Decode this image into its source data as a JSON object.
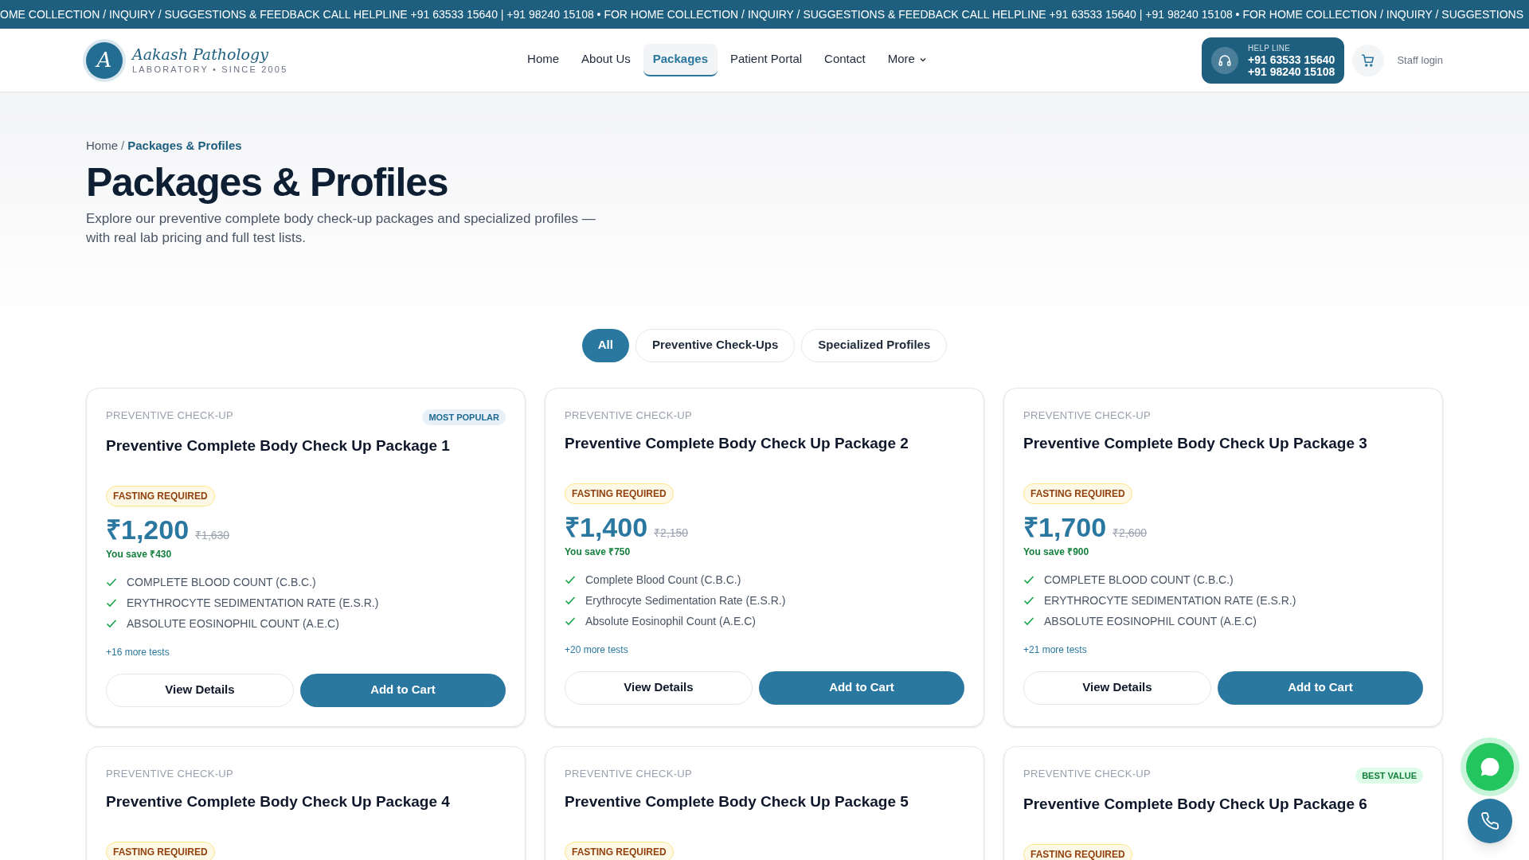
{
  "ticker": "OME COLLECTION / INQUIRY / SUGGESTIONS & FEEDBACK CALL HELPLINE +91 63533 15640 | +91 98240 15108 • FOR HOME COLLECTION / INQUIRY / SUGGESTIONS & FEEDBACK CALL HELPLINE +91 63533 15640 | +91 98240 15108 • FOR HOME COLLECTION / INQUIRY / SUGGESTIONS",
  "logo": {
    "letter": "A",
    "name": "Aakash Pathology",
    "tagline": "LABORATORY • SINCE 2005"
  },
  "nav": [
    {
      "label": "Home",
      "selected": false,
      "dropdown": false
    },
    {
      "label": "About Us",
      "selected": false,
      "dropdown": false
    },
    {
      "label": "Packages",
      "selected": true,
      "dropdown": false
    },
    {
      "label": "Patient Portal",
      "selected": false,
      "dropdown": false
    },
    {
      "label": "Contact",
      "selected": false,
      "dropdown": false
    },
    {
      "label": "More",
      "selected": false,
      "dropdown": true
    }
  ],
  "helpline": {
    "label": "HELP LINE",
    "numbers": [
      "+91 63533 15640",
      "+91 98240 15108"
    ]
  },
  "staff_login": "Staff login",
  "breadcrumb": [
    {
      "label": "Home",
      "selected": false
    },
    {
      "label": "Packages & Profiles",
      "selected": true
    }
  ],
  "breadcrumb_separator": "/",
  "title": "Packages & Profiles",
  "description": "Explore our preventive complete body check-up packages and specialized profiles — with real lab pricing and full test lists.",
  "filters": [
    {
      "label": "All",
      "selected": true
    },
    {
      "label": "Preventive Check-Ups",
      "selected": false
    },
    {
      "label": "Specialized Profiles",
      "selected": false
    }
  ],
  "cards": [
    {
      "category": "PREVENTIVE CHECK-UP",
      "badge": {
        "label": "MOST POPULAR",
        "kind": "popular"
      },
      "title": "Preventive Complete Body Check Up Package 1",
      "tag": "FASTING REQUIRED",
      "price": "₹1,200",
      "old_price": "₹1,630",
      "savings": "You save ₹430",
      "tests": [
        "COMPLETE BLOOD COUNT (C.B.C.)",
        "ERYTHROCYTE SEDIMENTATION RATE (E.S.R.)",
        "ABSOLUTE EOSINOPHIL COUNT (A.E.C)"
      ],
      "more": "+16 more tests",
      "actions": [
        "View Details",
        "Add to Cart"
      ]
    },
    {
      "category": "PREVENTIVE CHECK-UP",
      "title": "Preventive Complete Body Check Up Package 2",
      "tag": "FASTING REQUIRED",
      "price": "₹1,400",
      "old_price": "₹2,150",
      "savings": "You save ₹750",
      "tests": [
        "Complete Blood Count (C.B.C.)",
        "Erythrocyte Sedimentation Rate (E.S.R.)",
        "Absolute Eosinophil Count (A.E.C)"
      ],
      "more": "+20 more tests",
      "actions": [
        "View Details",
        "Add to Cart"
      ]
    },
    {
      "category": "PREVENTIVE CHECK-UP",
      "title": "Preventive Complete Body Check Up Package 3",
      "tag": "FASTING REQUIRED",
      "price": "₹1,700",
      "old_price": "₹2,600",
      "savings": "You save ₹900",
      "tests": [
        "COMPLETE BLOOD COUNT (C.B.C.)",
        "ERYTHROCYTE SEDIMENTATION RATE (E.S.R.)",
        "ABSOLUTE EOSINOPHIL COUNT (A.E.C)"
      ],
      "more": "+21 more tests",
      "actions": [
        "View Details",
        "Add to Cart"
      ]
    },
    {
      "category": "PREVENTIVE CHECK-UP",
      "title": "Preventive Complete Body Check Up Package 4",
      "tag": "FASTING REQUIRED"
    },
    {
      "category": "PREVENTIVE CHECK-UP",
      "title": "Preventive Complete Body Check Up Package 5",
      "tag": "FASTING REQUIRED"
    },
    {
      "category": "PREVENTIVE CHECK-UP",
      "badge": {
        "label": "BEST VALUE",
        "kind": "value"
      },
      "title": "Preventive Complete Body Check Up Package 6",
      "tag": "FASTING REQUIRED"
    }
  ]
}
